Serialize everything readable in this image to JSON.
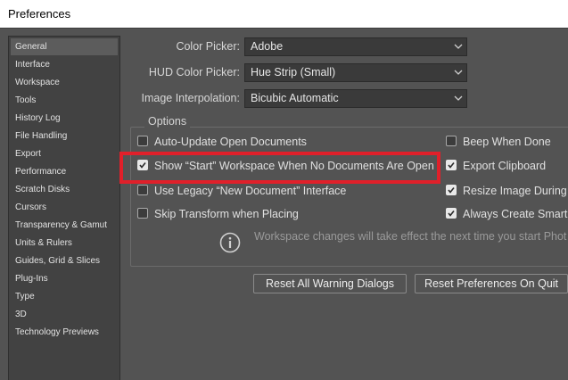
{
  "window": {
    "title": "Preferences"
  },
  "sidebar": {
    "items": [
      {
        "label": "General",
        "selected": true
      },
      {
        "label": "Interface",
        "selected": false
      },
      {
        "label": "Workspace",
        "selected": false
      },
      {
        "label": "Tools",
        "selected": false
      },
      {
        "label": "History Log",
        "selected": false
      },
      {
        "label": "File Handling",
        "selected": false
      },
      {
        "label": "Export",
        "selected": false
      },
      {
        "label": "Performance",
        "selected": false
      },
      {
        "label": "Scratch Disks",
        "selected": false
      },
      {
        "label": "Cursors",
        "selected": false
      },
      {
        "label": "Transparency & Gamut",
        "selected": false
      },
      {
        "label": "Units & Rulers",
        "selected": false
      },
      {
        "label": "Guides, Grid & Slices",
        "selected": false
      },
      {
        "label": "Plug-Ins",
        "selected": false
      },
      {
        "label": "Type",
        "selected": false
      },
      {
        "label": "3D",
        "selected": false
      },
      {
        "label": "Technology Previews",
        "selected": false
      }
    ]
  },
  "fields": {
    "color_picker": {
      "label": "Color Picker:",
      "value": "Adobe"
    },
    "hud_color_picker": {
      "label": "HUD Color Picker:",
      "value": "Hue Strip (Small)"
    },
    "image_interpolation": {
      "label": "Image Interpolation:",
      "value": "Bicubic Automatic"
    }
  },
  "options": {
    "title": "Options",
    "left": [
      {
        "label": "Auto-Update Open Documents",
        "checked": false
      },
      {
        "label": "Show “Start” Workspace When No Documents Are Open",
        "checked": true
      },
      {
        "label": "Use Legacy “New Document” Interface",
        "checked": false
      },
      {
        "label": "Skip Transform when Placing",
        "checked": false
      }
    ],
    "right": [
      {
        "label": "Beep When Done",
        "checked": false
      },
      {
        "label": "Export Clipboard",
        "checked": true
      },
      {
        "label": "Resize Image During",
        "checked": true
      },
      {
        "label": "Always Create Smart",
        "checked": true
      }
    ]
  },
  "info": {
    "icon": "info-icon",
    "text": "Workspace changes will take effect the next time you start Phot"
  },
  "buttons": {
    "reset_warnings": "Reset All Warning Dialogs",
    "reset_prefs": "Reset Preferences On Quit"
  },
  "colors": {
    "panel": "#535353",
    "highlight": "#e0202a"
  }
}
